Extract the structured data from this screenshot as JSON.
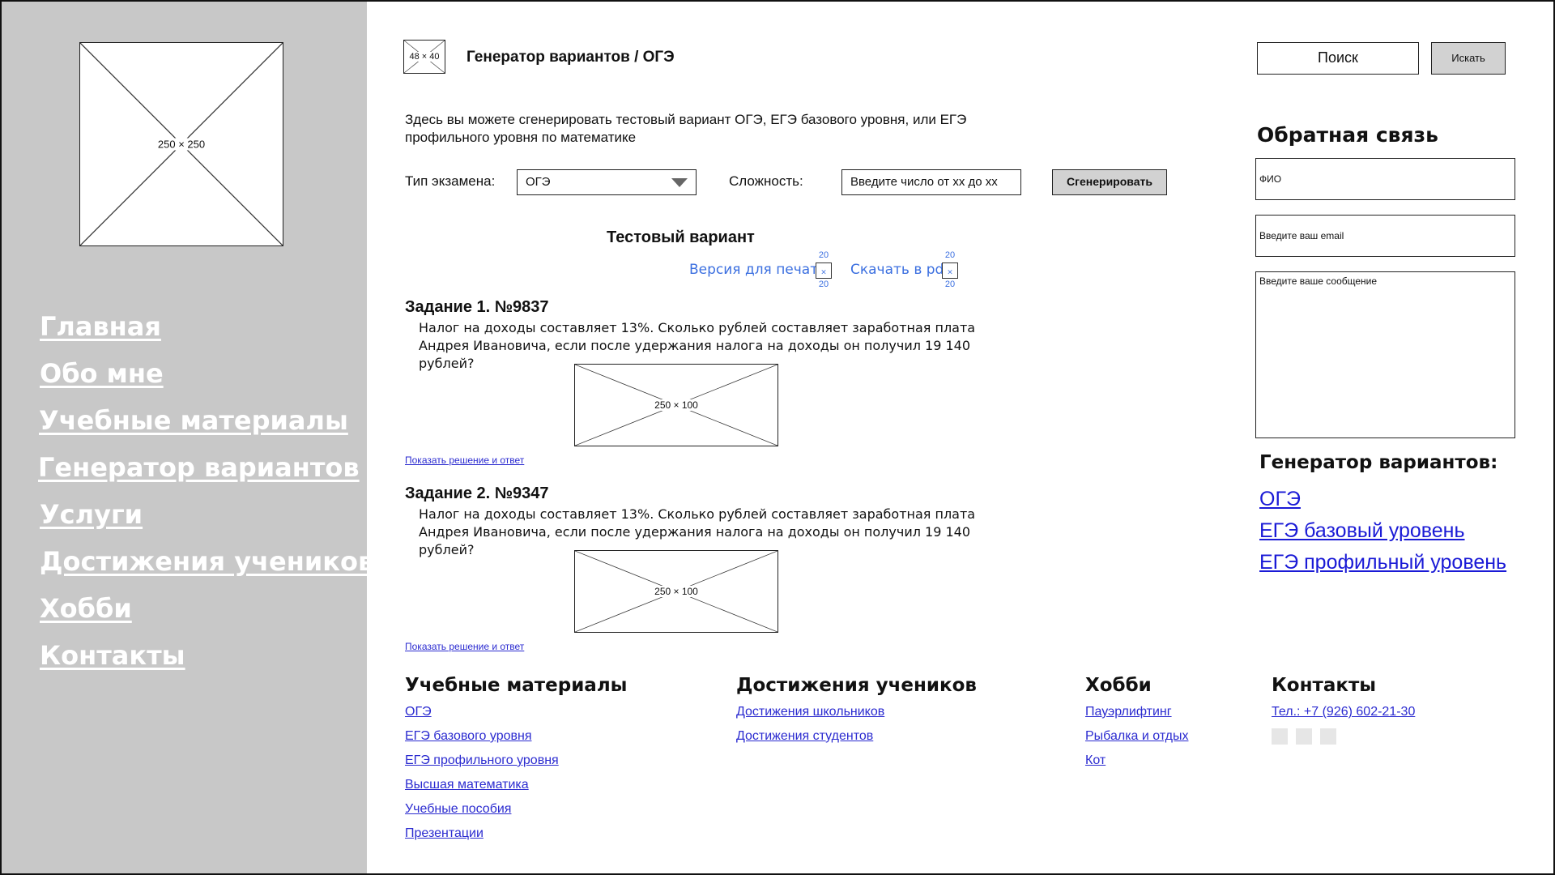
{
  "sidebar": {
    "logo_caption": "250 × 250",
    "nav": [
      "Главная",
      "Обо мне",
      "Учебные материалы",
      "Генератор вариантов",
      "Услуги",
      "Достижения учеников",
      "Хобби",
      "Контакты"
    ]
  },
  "header": {
    "small_logo_caption": "48 × 40",
    "breadcrumb": "Генератор вариантов / ОГЭ",
    "search_placeholder": "Поиск",
    "search_button": "Искать"
  },
  "intro": "Здесь вы можете сгенерировать тестовый вариант ОГЭ, ЕГЭ базового уровня, или ЕГЭ профильного уровня по математике",
  "controls": {
    "exam_label": "Тип экзамена:",
    "exam_value": "ОГЭ",
    "difficulty_label": "Сложность:",
    "difficulty_placeholder": "Введите число от хх до хх",
    "generate_button": "Сгенерировать"
  },
  "variant": {
    "title": "Тестовый вариант",
    "print_link": "Версия для печати",
    "pdf_link": "Скачать в pdf",
    "icon_size": "20"
  },
  "tasks": [
    {
      "title": "Задание 1. №9837",
      "text": "Налог на доходы составляет 13%. Сколько рублей составляет заработная плата Андрея Ивановича, если после удержания налога на доходы он получил 19 140 рублей?",
      "image_caption": "250 × 100",
      "solution_link": "Показать решение и ответ"
    },
    {
      "title": "Задание 2. №9347",
      "text": "Налог на доходы составляет 13%. Сколько рублей составляет заработная плата Андрея Ивановича, если после удержания налога на доходы он получил 19 140 рублей?",
      "image_caption": "250 × 100",
      "solution_link": "Показать решение и ответ"
    }
  ],
  "feedback": {
    "title": "Обратная связь",
    "name_placeholder": "ФИО",
    "email_placeholder": "Введите ваш email",
    "message_placeholder": "Введите ваше сообщение"
  },
  "generator": {
    "title": "Генератор вариантов:",
    "links": [
      "ОГЭ",
      "ЕГЭ базовый уровень",
      "ЕГЭ профильный уровень"
    ]
  },
  "footer": {
    "materials": {
      "title": "Учебные материалы",
      "links": [
        "ОГЭ",
        "ЕГЭ базового уровня",
        "ЕГЭ профильного уровня",
        "Высшая математика",
        "Учебные пособия",
        "Презентации"
      ]
    },
    "achievements": {
      "title": "Достижения учеников",
      "links": [
        "Достижения школьников",
        "Достижения студентов"
      ]
    },
    "hobby": {
      "title": "Хобби",
      "links": [
        "Пауэрлифтинг",
        "Рыбалка и отдых",
        "Кот"
      ]
    },
    "contacts": {
      "title": "Контакты",
      "phone": "Тел.: +7 (926) 602-21-30"
    }
  }
}
